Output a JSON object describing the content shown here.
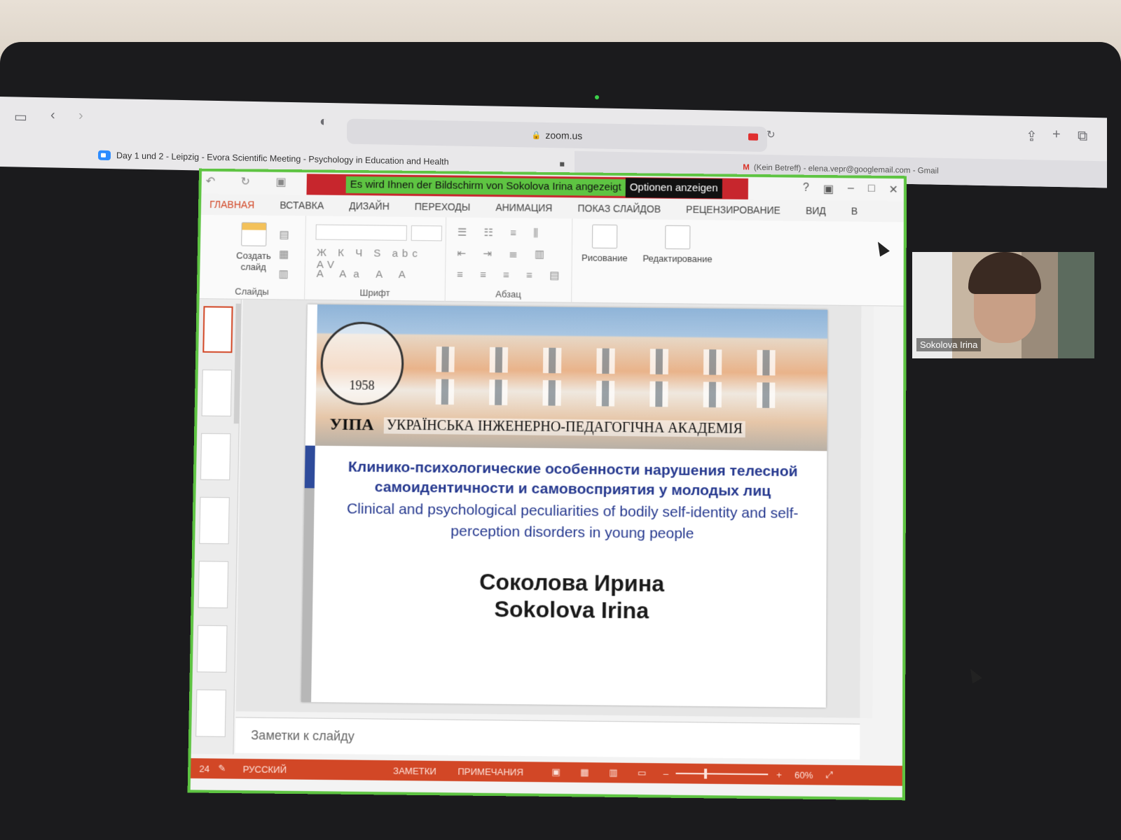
{
  "browser": {
    "url": "zoom.us",
    "tabs": [
      {
        "label": "Day 1 und 2 - Leipzig - Evora Scientific Meeting - Psychology in Education and Health",
        "active": true
      },
      {
        "label": "(Kein Betreff) - elena.vepr@googlemail.com - Gmail",
        "active": false
      }
    ]
  },
  "zoom": {
    "share_banner": "Es wird Ihnen der Bildschirm von Sokolova Irina angezeigt",
    "options_label": "Optionen anzeigen",
    "participant_name": "Sokolova Irina",
    "colors": {
      "share_border": "#5ec442",
      "banner_red": "#c7262d"
    }
  },
  "ppt": {
    "ribbon_tabs": [
      "ГЛАВНАЯ",
      "ВСТАВКА",
      "ДИЗАЙН",
      "ПЕРЕХОДЫ",
      "АНИМАЦИЯ",
      "ПОКАЗ СЛАЙДОВ",
      "РЕЦЕНЗИРОВАНИЕ",
      "ВИД",
      "В"
    ],
    "groups": {
      "slides": "Слайды",
      "font": "Шрифт",
      "paragraph": "Абзац"
    },
    "buttons": {
      "new_slide": "Создать слайд",
      "drawing": "Рисование",
      "editing": "Редактирование"
    },
    "font_buttons": "Ж К Ч S abc AV",
    "notes_placeholder": "Заметки к слайду",
    "status": {
      "slide_num": "24",
      "language": "РУССКИЙ",
      "notes": "ЗАМЕТКИ",
      "comments": "ПРИМЕЧАНИЯ",
      "zoom": "60%"
    },
    "accent": "#d24726"
  },
  "slide": {
    "seal_year": "1958",
    "abbr": "УІПА",
    "academy": "УКРАЇНСЬКА ІНЖЕНЕРНО-ПЕДАГОГІЧНА АКАДЕМІЯ",
    "title_ru": "Клинико-психологические особенности нарушения телесной самоидентичности и самовосприятия у молодых лиц",
    "title_en": "Clinical and psychological peculiarities of bodily self-identity and self-perception disorders in young people",
    "author_ru": "Соколова Ирина",
    "author_en": "Sokolova Irina"
  }
}
